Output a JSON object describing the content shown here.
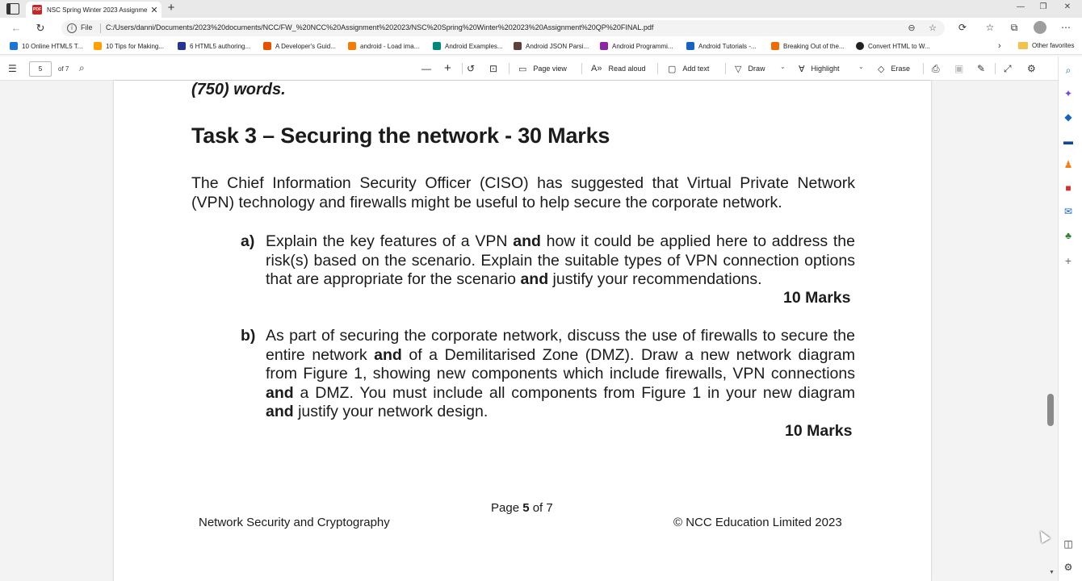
{
  "browser": {
    "tab_title": "NSC Spring Winter 2023 Assignme",
    "tab_favicon_text": "PDF",
    "address_prefix": "File",
    "url": "C:/Users/danni/Documents/2023%20documents/NCC/FW_%20NCC%20Assignment%202023/NSC%20Spring%20Winter%202023%20Assignment%20QP%20FINAL.pdf"
  },
  "bookmarks": [
    {
      "label": "10 Online HTML5 T...",
      "color": "#1976d2"
    },
    {
      "label": "10 Tips for Making...",
      "color": "#ffa000"
    },
    {
      "label": "6 HTML5 authoring...",
      "color": "#283593"
    },
    {
      "label": "A Developer's Guid...",
      "color": "#e65100"
    },
    {
      "label": "android - Load ima...",
      "color": "#f57c00"
    },
    {
      "label": "Android Examples...",
      "color": "#00897b"
    },
    {
      "label": "Android JSON Parsi...",
      "color": "#5d4037"
    },
    {
      "label": "Android Programmi...",
      "color": "#8e24aa"
    },
    {
      "label": "Android Tutorials -...",
      "color": "#1565c0"
    },
    {
      "label": "Breaking Out of the...",
      "color": "#ef6c00"
    },
    {
      "label": "Convert HTML to W...",
      "color": "#212121"
    }
  ],
  "other_favorites": "Other favorites",
  "pdf_toolbar": {
    "page_number": "5",
    "page_total": "of 7",
    "page_view": "Page view",
    "read_aloud": "Read aloud",
    "add_text": "Add text",
    "draw": "Draw",
    "highlight": "Highlight",
    "erase": "Erase"
  },
  "document": {
    "words_line": "(750) words.",
    "task_heading": "Task 3 – Securing the network - 30 Marks",
    "intro": "The Chief Information Security Officer (CISO) has suggested that Virtual Private Network (VPN) technology and firewalls might be useful to help secure the corporate network.",
    "question_a": {
      "label": "a)",
      "text_1": "Explain the key features of a VPN ",
      "bold_1": "and",
      "text_2": " how it could be applied here to address the risk(s) based on the scenario. Explain the suitable types of VPN connection options that are appropriate for the scenario ",
      "bold_2": "and",
      "text_3": " justify your recommendations.",
      "marks": "10 Marks"
    },
    "question_b": {
      "label": "b)",
      "text_1": "As part of securing the corporate network, discuss the use of firewalls to secure the entire network ",
      "bold_1": "and",
      "text_2": " of a Demilitarised Zone (DMZ). Draw a new network diagram from Figure 1, showing new components which include firewalls, VPN connections ",
      "bold_2": "and",
      "text_3": " a DMZ. You must include all components from Figure 1 in your new diagram ",
      "bold_3": "and",
      "text_4": " justify your network design.",
      "marks": "10 Marks"
    },
    "footer": {
      "course": "Network Security and Cryptography",
      "page_prefix": "Page ",
      "page_current": "5",
      "page_suffix": " of 7",
      "copyright": "© NCC Education Limited 2023"
    }
  }
}
